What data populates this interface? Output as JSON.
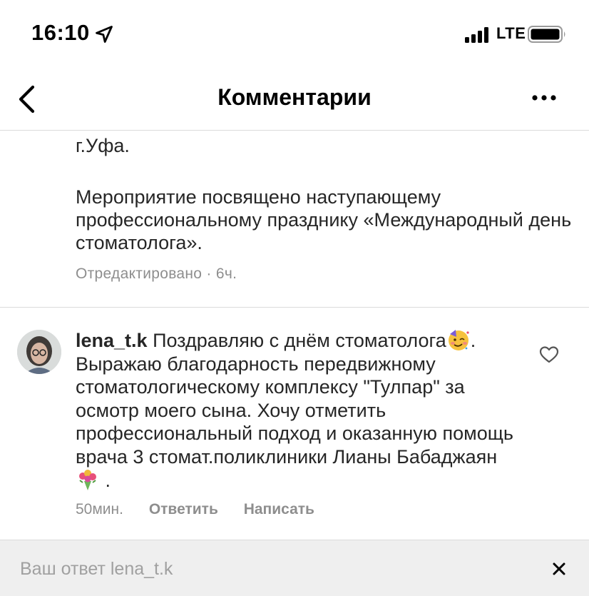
{
  "status_bar": {
    "time": "16:10",
    "carrier": "LTE",
    "icons": [
      "location-arrow-icon",
      "signal-bars-icon",
      "battery-icon"
    ]
  },
  "header": {
    "title": "Комментарии",
    "back_icon": "chevron-left-icon",
    "more_icon": "ellipsis-icon"
  },
  "post": {
    "caption_lines": [
      "г.Уфа.",
      "Мероприятие посвящено наступающему профессиональному празднику «Международный день стоматолога»."
    ],
    "meta": "Отредактировано · 6ч."
  },
  "comment": {
    "username": "lena_t.k",
    "text_part1": " Поздравляю с днём стоматолога",
    "emoji1": "partying-face-emoji",
    "text_part2": ". Выражаю благодарность передвижному стоматологическому комплексу \"Тулпар\" за осмотр моего сына. Хочу отметить профессиональный подход и оказанную помощь врача 3 стомат.поликлиники Лианы Бабаджаян",
    "emoji2": "bouquet-emoji",
    "text_part3": " .",
    "time": "50мин.",
    "reply_label": "Ответить",
    "message_label": "Написать"
  },
  "reply": {
    "placeholder": "Ваш ответ lena_t.k"
  },
  "colors": {
    "text": "#262626",
    "secondary": "#8e8e8e",
    "divider": "#dbdbdb",
    "reply_bar_bg": "#efefef"
  }
}
